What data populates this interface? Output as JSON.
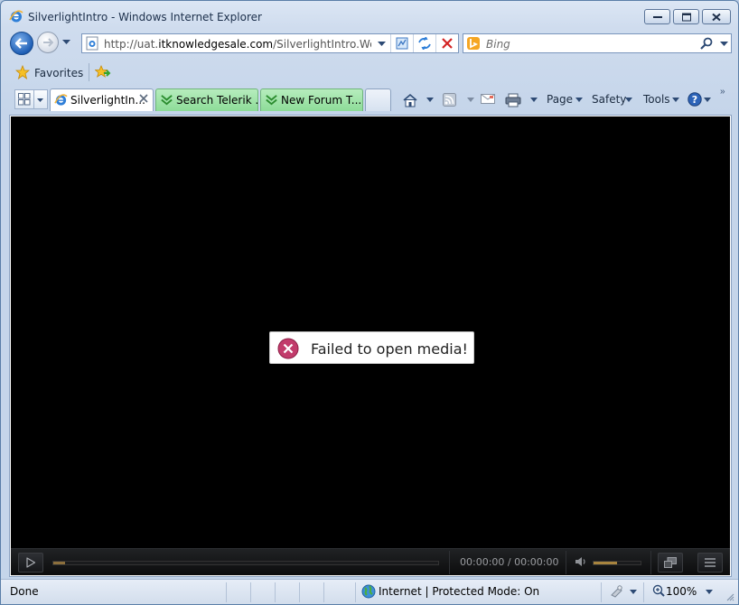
{
  "window": {
    "title": "SilverlightIntro - Windows Internet Explorer"
  },
  "address_bar": {
    "url_prefix": "http://uat.",
    "url_domain": "itknowledgesale.com",
    "url_rest": "/SilverlightIntro.Web/Silv"
  },
  "search": {
    "placeholder": "Bing"
  },
  "favorites_bar": {
    "label": "Favorites"
  },
  "tabs": [
    {
      "label": "SilverlightIn...",
      "active": true
    },
    {
      "label": "Search Telerik ...",
      "active": false
    },
    {
      "label": "New Forum T...",
      "active": false
    }
  ],
  "command_bar": {
    "page": "Page",
    "safety": "Safety",
    "tools": "Tools"
  },
  "player": {
    "error_message": "Failed to open media!",
    "time": "00:00:00 / 00:00:00",
    "progress_fraction": 0.03,
    "volume_fraction": 0.5
  },
  "status_bar": {
    "status": "Done",
    "zone": "Internet | Protected Mode: On",
    "zoom": "100%"
  },
  "colors": {
    "tab_group": "#8ddc98",
    "player_bg": "#000000",
    "error_icon": "#c23b6b"
  }
}
